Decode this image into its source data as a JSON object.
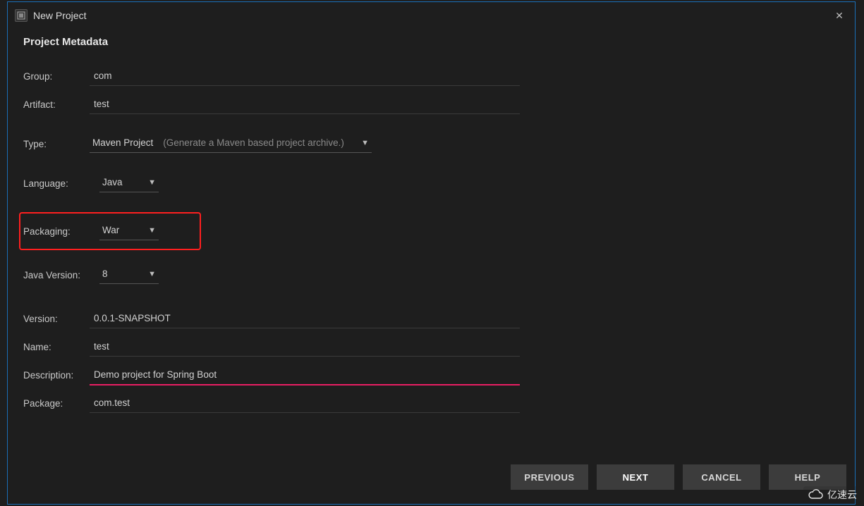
{
  "titlebar": {
    "title": "New Project"
  },
  "section": {
    "heading": "Project Metadata"
  },
  "fields": {
    "group_label": "Group:",
    "group_value": "com",
    "artifact_label": "Artifact:",
    "artifact_value": "test",
    "type_label": "Type:",
    "type_value": "Maven Project",
    "type_hint": "(Generate a Maven based project archive.)",
    "language_label": "Language:",
    "language_value": "Java",
    "packaging_label": "Packaging:",
    "packaging_value": "War",
    "javaversion_label": "Java Version:",
    "javaversion_value": "8",
    "version_label": "Version:",
    "version_value": "0.0.1-SNAPSHOT",
    "name_label": "Name:",
    "name_value": "test",
    "description_label": "Description:",
    "description_value": "Demo project for Spring Boot",
    "package_label": "Package:",
    "package_value": "com.test"
  },
  "buttons": {
    "previous": "PREVIOUS",
    "next": "NEXT",
    "cancel": "CANCEL",
    "help": "HELP"
  },
  "watermark": {
    "text": "亿速云"
  }
}
